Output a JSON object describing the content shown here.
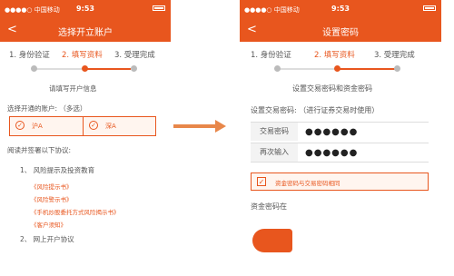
{
  "status": {
    "carrier": "●●●●○ 中国移动",
    "time": "9:53"
  },
  "left": {
    "title": "选择开立账户",
    "back": "<",
    "steps": [
      "1. 身份验证",
      "2. 填写资料",
      "3. 受理完成"
    ],
    "heading": "请填写开户信息",
    "accounts_label": "选择开通的账户: （多选）",
    "accounts": [
      "沪A",
      "深A"
    ],
    "agreement_label": "阅读并签署以下协议:",
    "sections": [
      "1、 风险提示及投资教育",
      "2、 网上开户协议"
    ],
    "links": [
      "《风险提示书》",
      "《风险警示书》",
      "《手机炒股委托方式风险揭示书》",
      "《客户须知》"
    ]
  },
  "right": {
    "title": "设置密码",
    "back": "<",
    "steps": [
      "1. 身份验证",
      "2. 填写资料",
      "3. 受理完成"
    ],
    "heading": "设置交易密码和资金密码",
    "pw_label": "设置交易密码: （进行证券交易时使用）",
    "fields": [
      {
        "key": "交易密码",
        "value": "●●●●●●"
      },
      {
        "key": "再次输入",
        "value": "●●●●●●"
      }
    ],
    "same_checkbox": "资金密码与交易密码相同",
    "fund_label": "资金密码在"
  }
}
